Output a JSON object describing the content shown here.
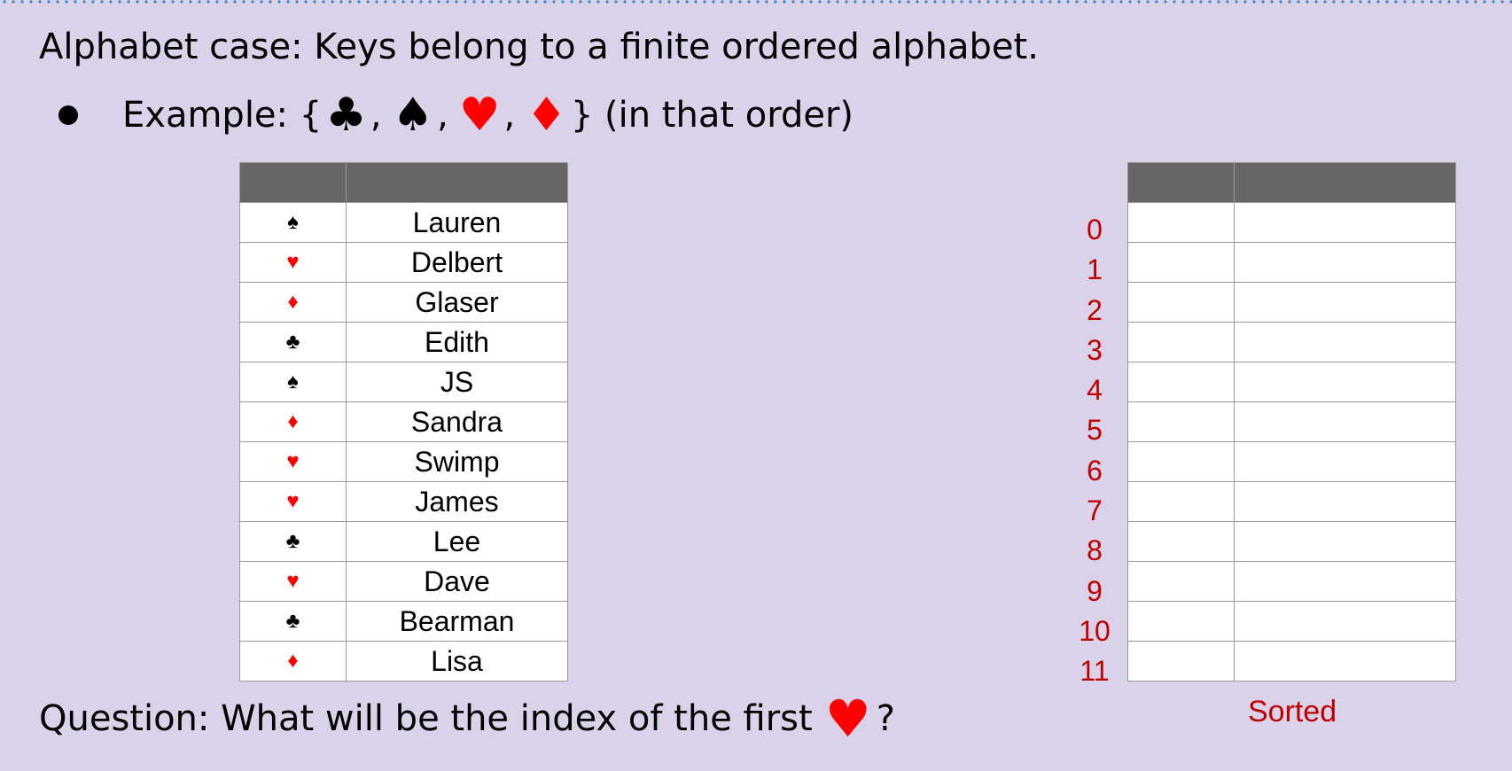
{
  "heading": "Alphabet case: Keys belong to a finite ordered alphabet.",
  "example": {
    "prefix": "Example: {",
    "comma": ",",
    "suffix": "} (in that order)",
    "order": [
      {
        "symbol": "♣",
        "color": "#000000",
        "name": "clubs"
      },
      {
        "symbol": "♠",
        "color": "#000000",
        "name": "spades"
      },
      {
        "symbol": "♥",
        "color": "#ff0000",
        "name": "hearts"
      },
      {
        "symbol": "♦",
        "color": "#ff0000",
        "name": "diamonds"
      }
    ]
  },
  "input_table": {
    "rows": [
      {
        "suit": "♠",
        "suit_color": "#000000",
        "name": "Lauren"
      },
      {
        "suit": "♥",
        "suit_color": "#ff0000",
        "name": "Delbert"
      },
      {
        "suit": "♦",
        "suit_color": "#ff0000",
        "name": "Glaser"
      },
      {
        "suit": "♣",
        "suit_color": "#000000",
        "name": "Edith"
      },
      {
        "suit": "♠",
        "suit_color": "#000000",
        "name": "JS"
      },
      {
        "suit": "♦",
        "suit_color": "#ff0000",
        "name": "Sandra"
      },
      {
        "suit": "♥",
        "suit_color": "#ff0000",
        "name": "Swimp"
      },
      {
        "suit": "♥",
        "suit_color": "#ff0000",
        "name": "James"
      },
      {
        "suit": "♣",
        "suit_color": "#000000",
        "name": "Lee"
      },
      {
        "suit": "♥",
        "suit_color": "#ff0000",
        "name": "Dave"
      },
      {
        "suit": "♣",
        "suit_color": "#000000",
        "name": "Bearman"
      },
      {
        "suit": "♦",
        "suit_color": "#ff0000",
        "name": "Lisa"
      }
    ]
  },
  "sorted_table": {
    "indices": [
      "0",
      "1",
      "2",
      "3",
      "4",
      "5",
      "6",
      "7",
      "8",
      "9",
      "10",
      "11"
    ],
    "label": "Sorted",
    "index_color": "#c00000"
  },
  "question": {
    "prefix": "Question: What will be the index of the first",
    "symbol": "♥",
    "symbol_color": "#ff0000",
    "suffix": "?"
  },
  "colors": {
    "background": "#d9d2e9",
    "header_fill": "#666666",
    "dotted_rule": "#3d85c6"
  }
}
